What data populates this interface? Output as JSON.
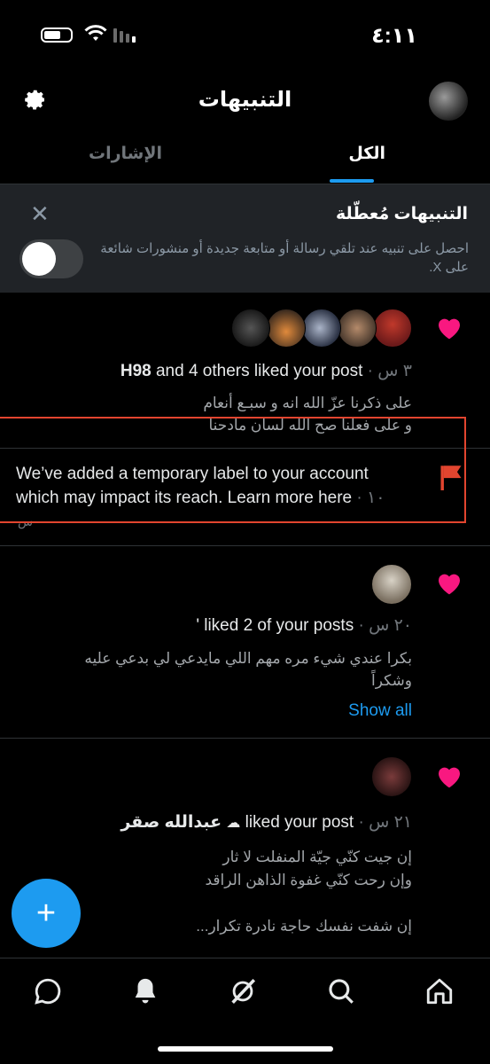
{
  "status_bar": {
    "time": "٤:١١"
  },
  "header": {
    "title": "التنبيهات"
  },
  "tabs": [
    {
      "label": "الكل",
      "active": true
    },
    {
      "label": "الإشارات",
      "active": false
    }
  ],
  "banner": {
    "title": "التنبيهات مُعطّلة",
    "text": "احصل على تنبيه عند تلقي رسالة أو متابعة جديدة أو منشورات شائعة على X."
  },
  "notifications": {
    "n1": {
      "user": "H98",
      "action": " and 4 others liked your post",
      "time": " · ٣ س",
      "text_line1": "على ذكرنا عزّ الله انه و سبـع أنعام",
      "text_line2": "و على فعلنا صح الله لسان مادحنا"
    },
    "n2": {
      "text": "We’ve added a temporary label to your account which may impact its reach. Learn more here",
      "time": " · ١٠",
      "time_suffix": "س"
    },
    "n3": {
      "action": "' liked 2 of your posts",
      "time": " · ٢٠ س",
      "text_line1": "بكرا عندي شيء مره مهم اللي مايدعي لي بدعي عليه",
      "text_line2": "وشكراً",
      "show_all": "Show all"
    },
    "n4": {
      "user": "عبدالله صقر",
      "action": " liked your post",
      "time": " · ٢١ س",
      "text_line1": "إن جيت كنّي جيّة المنفلت لا ثار",
      "text_line2": "وإن رحت كنّي غفوة الذاهن الراقد",
      "text_line3": "إن شفت نفسك حاجة نادرة تكرار..."
    }
  },
  "colors": {
    "accent": "#1d9bf0",
    "like": "#f91880",
    "flag": "#e2452f",
    "highlight_border": "#e2452f"
  }
}
